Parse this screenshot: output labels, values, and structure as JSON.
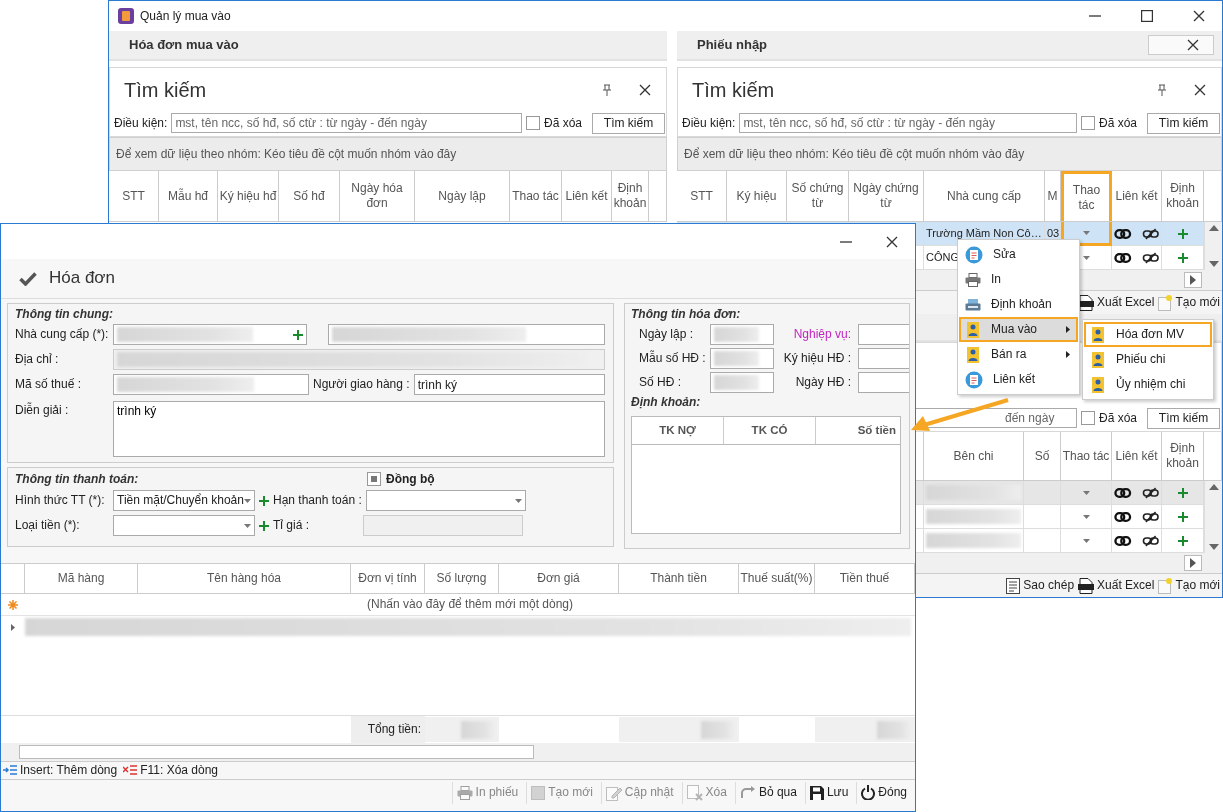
{
  "main_window": {
    "title": "Quản lý mua vào"
  },
  "left_pane": {
    "title": "Hóa đơn mua vào",
    "search": {
      "title": "Tìm kiếm",
      "label": "Điều kiện:",
      "placeholder": "mst, tên ncc, số hđ, số ctừ : từ ngày - đến ngày",
      "deleted_label": "Đã xóa",
      "deleted_checked": false,
      "button": "Tìm kiếm"
    },
    "group_hint": "Để xem dữ liệu theo nhóm: Kéo tiêu đề cột muốn nhóm vào đây",
    "columns": [
      {
        "label": "STT",
        "highlighted": false
      },
      {
        "label": "Mẫu hđ",
        "highlighted": false
      },
      {
        "label": "Ký hiệu hđ",
        "highlighted": false
      },
      {
        "label": "Số hđ",
        "highlighted": false
      },
      {
        "label": "Ngày hóa đơn",
        "highlighted": false
      },
      {
        "label": "Ngày lập",
        "highlighted": false
      },
      {
        "label": "Thao tác",
        "highlighted": false
      },
      {
        "label": "Liên kết",
        "highlighted": false
      },
      {
        "label": "Định khoản",
        "highlighted": false
      }
    ]
  },
  "right_pane": {
    "title": "Phiếu nhập",
    "search": {
      "title": "Tìm kiếm",
      "label": "Điều kiện:",
      "placeholder": "mst, tên ncc, số hđ, số ctừ : từ ngày - đến ngày",
      "deleted_label": "Đã xóa",
      "deleted_checked": false,
      "button": "Tìm kiếm"
    },
    "group_hint": "Để xem dữ liệu theo nhóm: Kéo tiêu đề cột muốn nhóm vào đây",
    "columns": [
      {
        "label": "STT",
        "highlighted": false
      },
      {
        "label": "Ký hiệu",
        "highlighted": false
      },
      {
        "label": "Số chứng từ",
        "highlighted": false
      },
      {
        "label": "Ngày chứng từ",
        "highlighted": false
      },
      {
        "label": "Nhà cung cấp",
        "highlighted": false
      },
      {
        "label": "M",
        "highlighted": false
      },
      {
        "label": "Thao tác",
        "highlighted": true
      },
      {
        "label": "Liên kết",
        "highlighted": false
      },
      {
        "label": "Định khoản",
        "highlighted": false
      }
    ],
    "rows": [
      {
        "supplier": "Trường Mầm Non Cô…",
        "code": "03",
        "selected": true
      },
      {
        "supplier": "CÔNG",
        "selected": false
      }
    ],
    "toolbar": [
      {
        "label": "Xuất Excel",
        "kind": "excel"
      },
      {
        "label": "Tạo mới",
        "kind": "new"
      }
    ],
    "lower": {
      "search": {
        "placeholder": "đến ngày",
        "deleted_label": "Đã xóa",
        "deleted_checked": false,
        "button": "Tìm kiếm"
      },
      "columns": [
        {
          "label": "Bên chi",
          "highlighted": false
        },
        {
          "label": "Số",
          "highlighted": false
        },
        {
          "label": "Thao tác",
          "highlighted": false
        },
        {
          "label": "Liên kết",
          "highlighted": false
        },
        {
          "label": "Định khoản",
          "highlighted": false
        }
      ],
      "rows": [
        {
          "selected": true
        },
        {
          "selected": false
        },
        {
          "selected": false
        }
      ],
      "toolbar": [
        {
          "label": "Sao chép",
          "kind": "copy"
        },
        {
          "label": "Xuất Excel",
          "kind": "excel"
        },
        {
          "label": "Tạo mới",
          "kind": "new"
        }
      ]
    }
  },
  "context_menu": {
    "items": [
      {
        "label": "Sửa",
        "kind": "edit",
        "submenu": false,
        "selected": false
      },
      {
        "label": "In",
        "kind": "print",
        "submenu": false,
        "selected": false
      },
      {
        "label": "Định khoản",
        "kind": "ledger",
        "submenu": false,
        "selected": false
      },
      {
        "label": "Mua vào",
        "kind": "invoice",
        "submenu": true,
        "selected": true
      },
      {
        "label": "Bán ra",
        "kind": "invoice",
        "submenu": true,
        "selected": false
      },
      {
        "label": "Liên kết",
        "kind": "edit",
        "submenu": false,
        "selected": false
      }
    ]
  },
  "submenu": {
    "items": [
      {
        "label": "Hóa đơn MV",
        "kind": "invoice",
        "selected": true
      },
      {
        "label": "Phiếu chi",
        "kind": "invoice",
        "selected": false
      },
      {
        "label": "Ủy nhiệm chi",
        "kind": "invoice",
        "selected": false
      }
    ]
  },
  "dialog": {
    "title": "Hóa đơn",
    "general": {
      "title": "Thông tin chung:",
      "supplier_label": "Nhà cung cấp (*):",
      "address_label": "Địa chỉ :",
      "tax_code_label": "Mã số thuế :",
      "deliverer_label": "Người giao hàng :",
      "deliverer": "trình ký",
      "description_label": "Diễn giải :",
      "description": "trình ký"
    },
    "payment": {
      "title": "Thông tin thanh toán:",
      "sync_label": "Đồng bộ",
      "sync_checked": true,
      "method_label": "Hình thức TT (*):",
      "method": "Tiền mặt/Chuyển khoản",
      "due_label": "Hạn thanh toán :",
      "currency_label": "Loại tiền (*):",
      "rate_label": "Tỉ giá :"
    },
    "invoice": {
      "title": "Thông tin hóa đơn:",
      "date_label": "Ngày lập :",
      "business_label": "Nghiệp vụ:",
      "form_label": "Mẫu số HĐ :",
      "symbol_label": "Ký hiệu HĐ :",
      "number_label": "Số HĐ :",
      "invoice_date_label": "Ngày HĐ :",
      "accounting_title": "Định khoản:",
      "accounting_columns": [
        "TK NỢ",
        "TK CÓ",
        "Số tiền"
      ]
    },
    "items": {
      "columns": [
        "Mã hàng",
        "Tên hàng hóa",
        "Đơn vị tính",
        "Số lượng",
        "Đơn giá",
        "Thành tiền",
        "Thuế suất(%)",
        "Tiền thuế"
      ],
      "new_row_hint": "(Nhấn vào đây để thêm mới một dòng)",
      "total_label": "Tổng tiền:"
    },
    "shortcuts": [
      {
        "label": "Insert: Thêm dòng",
        "kind": "insert"
      },
      {
        "label": "F11: Xóa dòng",
        "kind": "remove"
      }
    ],
    "buttons": [
      {
        "label": "In phiếu",
        "kind": "print",
        "disabled": true
      },
      {
        "label": "Tạo mới",
        "kind": "blank",
        "disabled": true
      },
      {
        "label": "Cập nhật",
        "kind": "update",
        "disabled": true
      },
      {
        "label": "Xóa",
        "kind": "delete",
        "disabled": true
      },
      {
        "label": "Bỏ qua",
        "kind": "skip",
        "disabled": false
      },
      {
        "label": "Lưu",
        "kind": "save",
        "disabled": false
      },
      {
        "label": "Đóng",
        "kind": "power",
        "disabled": false
      }
    ]
  }
}
